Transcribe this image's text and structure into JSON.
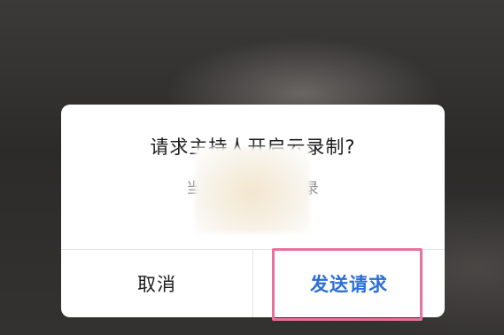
{
  "dialog": {
    "title": "请求主持人开启云录制?",
    "message": "当前会议                        进行云录",
    "cancel_label": "取消",
    "confirm_label": "发送请求"
  },
  "colors": {
    "confirm_text": "#2a6fd6",
    "highlight_border": "#e8729e"
  }
}
